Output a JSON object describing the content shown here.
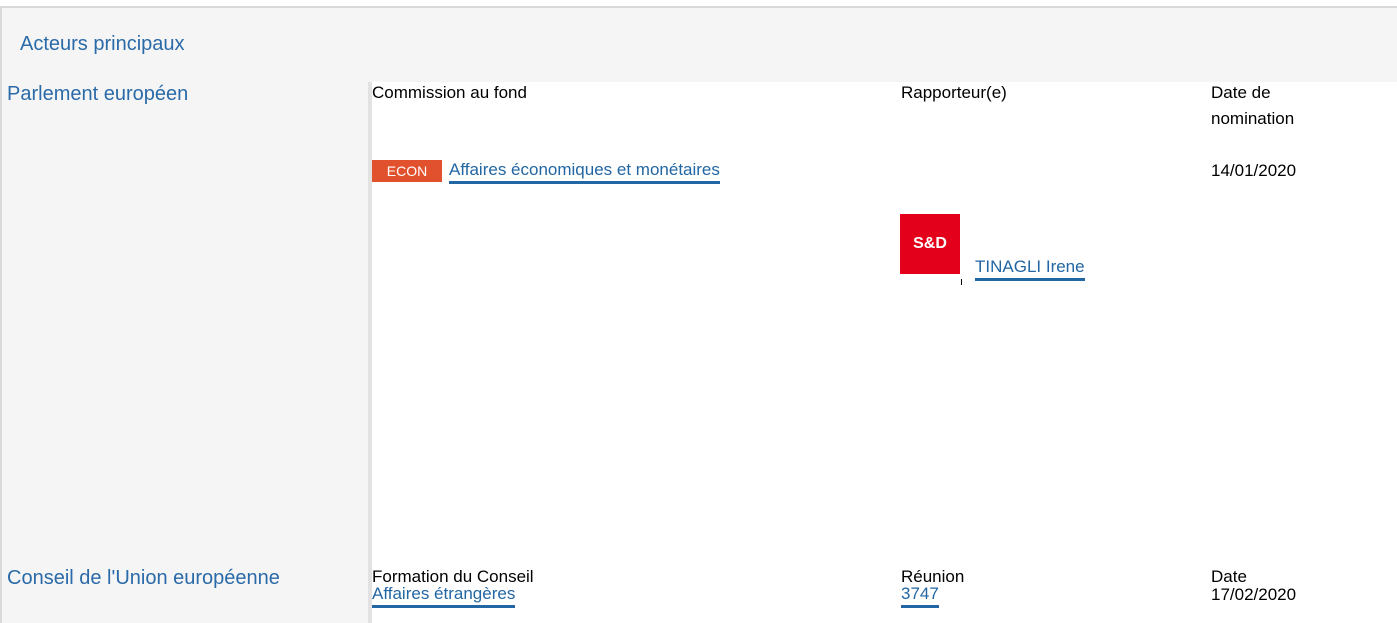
{
  "header": {
    "title": "Acteurs principaux"
  },
  "parliament": {
    "label": "Parlement européen",
    "col_committee": "Commission au fond",
    "col_rapporteur": "Rapporteur(e)",
    "col_date": "Date de nomination",
    "committee_badge": "ECON",
    "committee_link": "Affaires économiques et monétaires",
    "nomination_date": "14/01/2020",
    "rapporteur_logo": "S&D",
    "rapporteur_link": "TINAGLI Irene"
  },
  "council": {
    "label": "Conseil de l'Union européenne",
    "col_formation": "Formation du Conseil",
    "col_meeting": "Réunion",
    "col_date": "Date",
    "formation_link": "Affaires étrangères",
    "meeting_link": "3747",
    "date": "17/02/2020"
  },
  "colors": {
    "header_text": "#2a6aa8",
    "link": "#2266a3",
    "badge": "#e2512d",
    "sd_logo": "#e3001b",
    "panel_bg": "#f5f5f5"
  }
}
